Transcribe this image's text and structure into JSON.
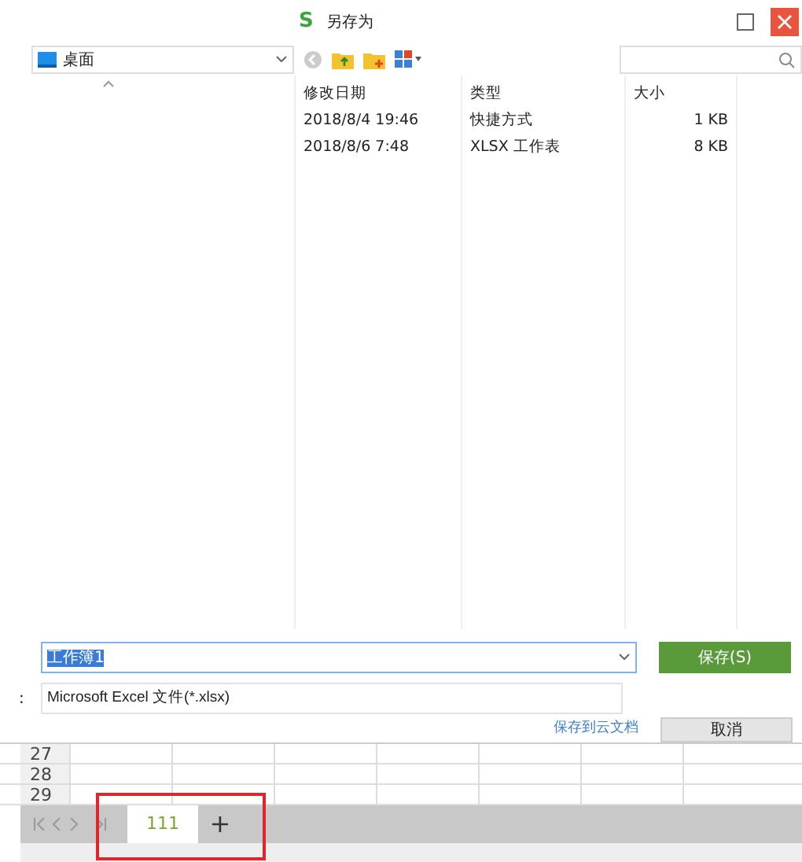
{
  "window": {
    "logo": "S",
    "title": "另存为"
  },
  "location": {
    "value": "桌面"
  },
  "file_list": {
    "columns": [
      "修改日期",
      "类型",
      "大小"
    ],
    "rows": [
      {
        "cells": [
          "2018/8/4 19:46",
          "快捷方式",
          "1 KB"
        ]
      },
      {
        "cells": [
          "2018/8/6 7:48",
          "XLSX 工作表",
          "8 KB"
        ]
      }
    ]
  },
  "file_name": {
    "value": "工作簿1",
    "highlighted": true
  },
  "save_type": {
    "label": ":",
    "value": "Microsoft Excel 文件(*.xlsx)"
  },
  "cloud_link": "保存到云文档",
  "buttons": [
    {
      "label": "保存(S)",
      "kind": "primary"
    },
    {
      "label": "取消",
      "kind": "secondary"
    }
  ],
  "sheet": {
    "row_numbers": [
      "27",
      "28",
      "29"
    ],
    "tabs": [
      {
        "label": "111",
        "selected": true
      }
    ],
    "add_label": "+"
  }
}
